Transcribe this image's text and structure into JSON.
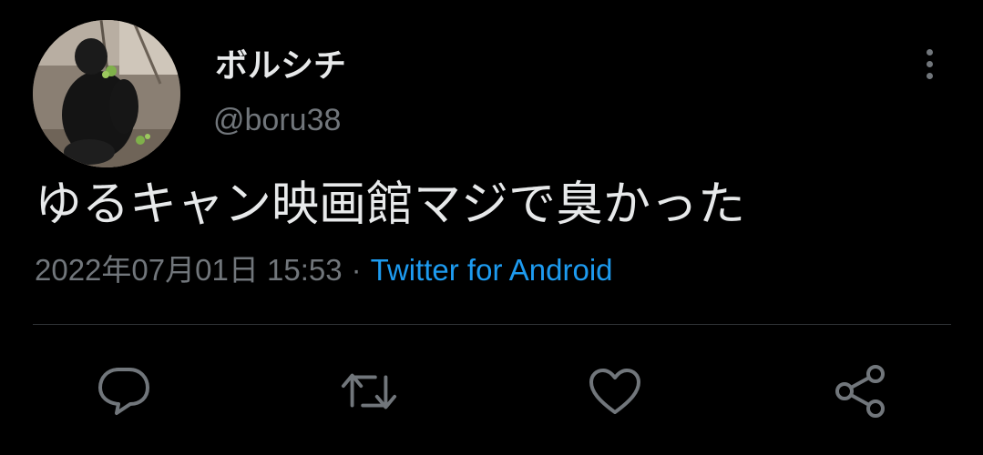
{
  "author": {
    "display_name": "ボルシチ",
    "handle": "@boru38",
    "avatar_icon": "gorilla-avatar"
  },
  "tweet": {
    "text": "ゆるキャン映画館マジで臭かった",
    "timestamp": "2022年07月01日 15:53",
    "separator": "·",
    "source": "Twitter for Android"
  },
  "actions": {
    "reply_icon": "reply-icon",
    "retweet_icon": "retweet-icon",
    "like_icon": "like-icon",
    "share_icon": "share-icon",
    "more_icon": "more-vertical-icon"
  },
  "colors": {
    "background": "#000000",
    "primary_text": "#e7e9ea",
    "secondary_text": "#71767b",
    "link": "#1d9bf0",
    "divider": "#2f3336"
  }
}
